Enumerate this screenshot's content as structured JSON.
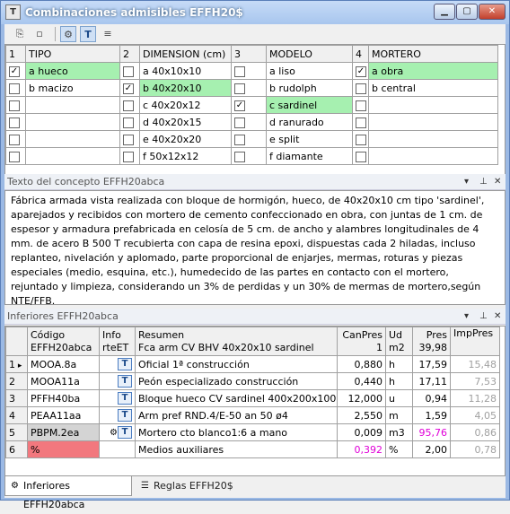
{
  "window": {
    "title": "Combinaciones admisibles EFFH20$",
    "app_icon": "T",
    "min": "▁",
    "max": "▢",
    "close": "✕"
  },
  "toolbar": {
    "icons": [
      "copy-icon",
      "checkbox-icon",
      "tree-icon",
      "text-t-icon",
      "align-icon"
    ]
  },
  "combos": {
    "headers": [
      "1",
      "TIPO",
      "2",
      "DIMENSION (cm)",
      "3",
      "MODELO",
      "4",
      "MORTERO"
    ],
    "rows": [
      {
        "c1": true,
        "tipo": "a hueco",
        "c2": false,
        "dim": "a 40x10x10",
        "c3": false,
        "mod": "a liso",
        "c4": true,
        "mort": "a obra"
      },
      {
        "c1": false,
        "tipo": "b macizo",
        "c2": true,
        "dim": "b 40x20x10",
        "c3": false,
        "mod": "b rudolph",
        "c4": false,
        "mort": "b central"
      },
      {
        "c1": false,
        "tipo": "",
        "c2": false,
        "dim": "c 40x20x12",
        "c3": true,
        "mod": "c sardinel",
        "c4": false,
        "mort": ""
      },
      {
        "c1": false,
        "tipo": "",
        "c2": false,
        "dim": "d 40x20x15",
        "c3": false,
        "mod": "d ranurado",
        "c4": false,
        "mort": ""
      },
      {
        "c1": false,
        "tipo": "",
        "c2": false,
        "dim": "e 40x20x20",
        "c3": false,
        "mod": "e split",
        "c4": false,
        "mort": ""
      },
      {
        "c1": false,
        "tipo": "",
        "c2": false,
        "dim": "f 50x12x12",
        "c3": false,
        "mod": "f diamante",
        "c4": false,
        "mort": ""
      }
    ],
    "selected": {
      "tipo": 0,
      "dim": 1,
      "mod": 2,
      "mort": 0
    }
  },
  "concept": {
    "title": "Texto del concepto EFFH20abca",
    "text": "Fábrica armada vista realizada con bloque de hormigón, hueco, de 40x20x10 cm tipo 'sardinel', aparejados y recibidos con mortero de cemento confeccionado en obra, con juntas de 1 cm. de espesor y  armadura prefabricada en celosía de 5 cm. de ancho y alambres longitudinales de 4 mm. de acero B 500 T recubierta con capa de resina epoxi, dispuestas cada 2 hiladas, incluso replanteo, nivelación y aplomado, parte proporcional de enjarjes, mermas, roturas y piezas especiales (medio, esquina, etc.), humedecido de las partes en contacto con el mortero, rejuntado y limpieza, considerando un 3% de perdidas y un 30% de mermas de mortero,según NTE/FFB."
  },
  "inferiores": {
    "title": "Inferiores EFFH20abca",
    "headers": {
      "codigo": "Código",
      "codigo2": "EFFH20abca",
      "info": "Info",
      "info2": "rteET",
      "resumen": "Resumen",
      "resumen2": "Fca arm CV BHV 40x20x10 sardinel",
      "canpres": "CanPres",
      "canpres2": "1",
      "ud": "Ud",
      "ud2": "m2",
      "pres": "Pres",
      "pres2": "39,98",
      "imppres": "ImpPres"
    },
    "rows": [
      {
        "n": "1",
        "codigo": "MOOA.8a",
        "resumen": "Oficial 1ª construcción",
        "canpres": "0,880",
        "ud": "h",
        "pres": "17,59",
        "imppres": "15,48"
      },
      {
        "n": "2",
        "codigo": "MOOA11a",
        "resumen": "Peón especializado construcción",
        "canpres": "0,440",
        "ud": "h",
        "pres": "17,11",
        "imppres": "7,53"
      },
      {
        "n": "3",
        "codigo": "PFFH40ba",
        "resumen": "Bloque hueco CV sardinel 400x200x100",
        "canpres": "12,000",
        "ud": "u",
        "pres": "0,94",
        "imppres": "11,28"
      },
      {
        "n": "4",
        "codigo": "PEAA11aa",
        "resumen": "Arm pref RND.4/E-50 an 50 ø4",
        "canpres": "2,550",
        "ud": "m",
        "pres": "1,59",
        "imppres": "4,05"
      },
      {
        "n": "5",
        "codigo": "PBPM.2ea",
        "resumen": "Mortero cto blanco1:6 a mano",
        "canpres": "0,009",
        "ud": "m3",
        "pres": "95,76",
        "imppres": "0,86"
      },
      {
        "n": "6",
        "codigo": "%",
        "resumen": "Medios auxiliares",
        "canpres": "0,392",
        "ud": "%",
        "pres": "2,00",
        "imppres": "0,78"
      }
    ]
  },
  "tabs": {
    "inferiores": "Inferiores EFFH20abca",
    "reglas": "Reglas EFFH20$"
  },
  "colors": {
    "highlight": "#a6f0b0",
    "code_pink": "#f2787e",
    "magenta": "#e000d8"
  }
}
